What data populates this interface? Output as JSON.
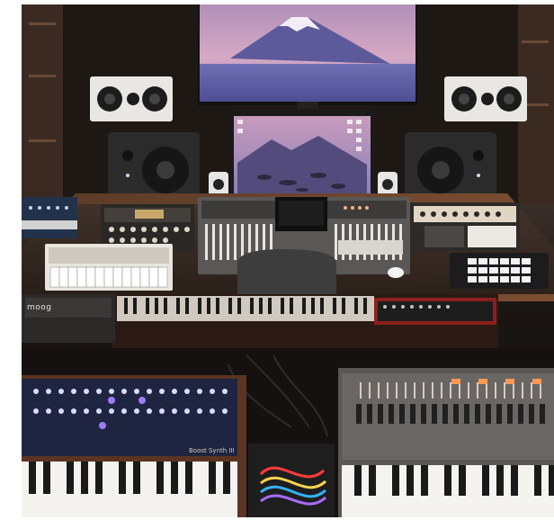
{
  "scene": {
    "labels": {
      "left_synth_badge": "moog",
      "left_keyboard_model": "Boost Synth III"
    }
  }
}
